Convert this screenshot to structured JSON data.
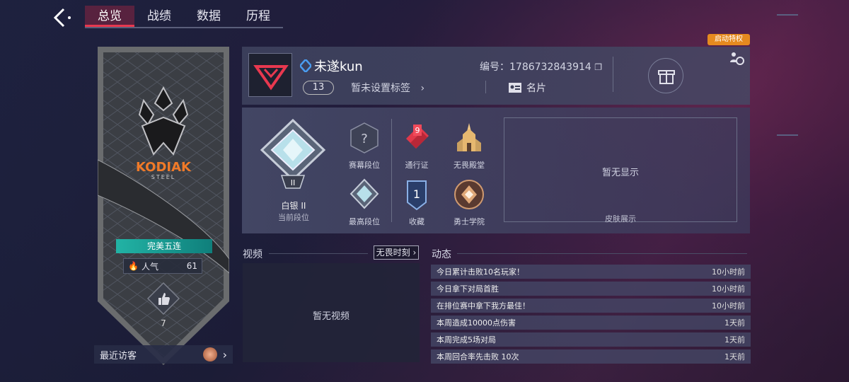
{
  "nav": {
    "tabs": [
      {
        "label": "总览"
      },
      {
        "label": "战绩"
      },
      {
        "label": "数据"
      },
      {
        "label": "历程"
      }
    ]
  },
  "left_card": {
    "brand": "KODIAK",
    "brand_sub": "STEEL",
    "banner": "完美五连",
    "popularity_label": "人气",
    "popularity_value": "61",
    "likes": "7",
    "visitors_label": "最近访客"
  },
  "profile": {
    "name": "未遂kun",
    "level": "13",
    "tag": "暂未设置标签",
    "id_text": "编号：1786732843914",
    "namecard": "名片",
    "boost": "启动特权"
  },
  "rank": {
    "current_rank": "白银 II",
    "current_label": "当前段位",
    "items": [
      {
        "label": "赛幕段位"
      },
      {
        "label": "通行证",
        "badge": "9"
      },
      {
        "label": "无畏殿堂"
      },
      {
        "label": "最高段位"
      },
      {
        "label": "收藏",
        "badge": "1"
      },
      {
        "label": "勇士学院"
      }
    ],
    "skin_empty": "暂无显示",
    "skin_label": "皮肤展示"
  },
  "video": {
    "title": "视频",
    "moment_button": "无畏时刻",
    "empty": "暂无视频"
  },
  "activity": {
    "title": "动态",
    "rows": [
      {
        "text": "今日累计击败10名玩家！",
        "time": "10小时前"
      },
      {
        "text": "今日拿下对局首胜",
        "time": "10小时前"
      },
      {
        "text": "在排位赛中拿下我方最佳！",
        "time": "10小时前"
      },
      {
        "text": "本周造成10000点伤害",
        "time": "1天前"
      },
      {
        "text": "本周完成5场对局",
        "time": "1天前"
      },
      {
        "text": "本周回合率先击败 10次",
        "time": "1天前"
      }
    ]
  },
  "colors": {
    "accent": "#e8384f",
    "banner": "#22b3a5",
    "boost": "#e58a1f"
  }
}
